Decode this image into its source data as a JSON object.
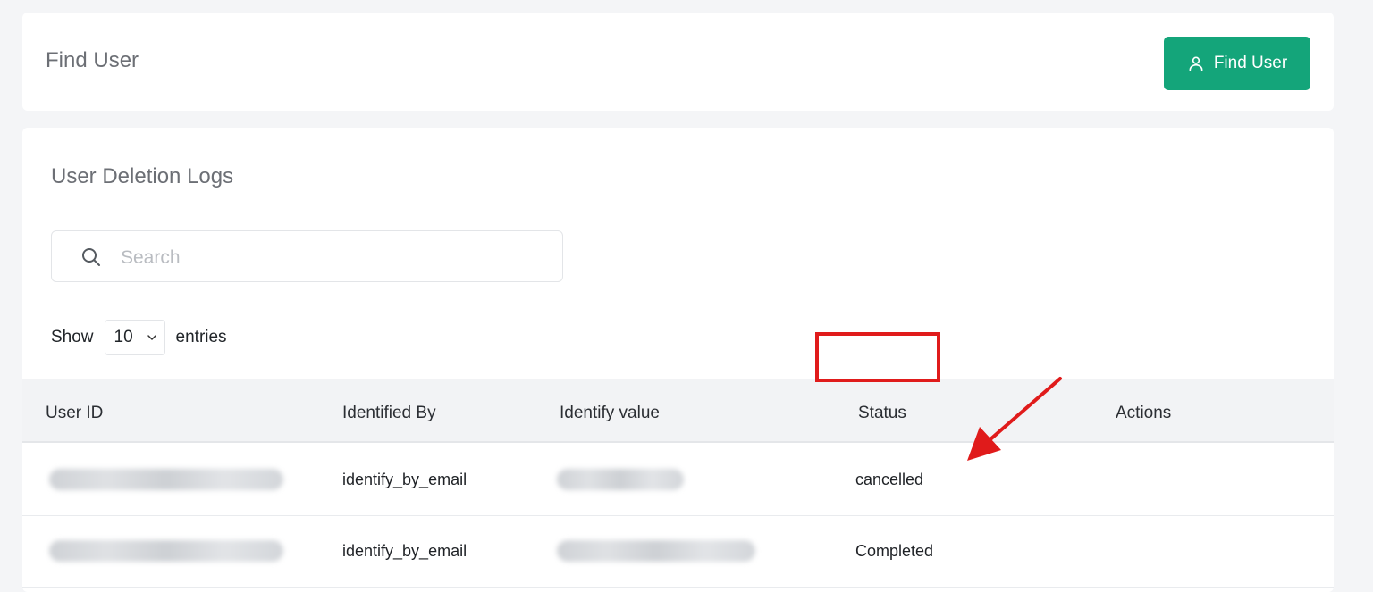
{
  "top_card": {
    "title": "Find User",
    "button_label": "Find User",
    "button_icon": "user-icon"
  },
  "logs": {
    "title": "User Deletion Logs",
    "search": {
      "placeholder": "Search",
      "value": "",
      "icon": "search-icon"
    },
    "show_label": "Show",
    "entries_value": "10",
    "entries_label": "entries",
    "columns": [
      "User ID",
      "Identified By",
      "Identify value",
      "Status",
      "Actions"
    ],
    "rows": [
      {
        "user_id": "",
        "identified_by": "identify_by_email",
        "identify_value": "",
        "status": "cancelled",
        "actions": ""
      },
      {
        "user_id": "",
        "identified_by": "identify_by_email",
        "identify_value": "",
        "status": "Completed",
        "actions": ""
      }
    ]
  },
  "colors": {
    "accent": "#14a57a",
    "annotation": "#e01b1b",
    "page_background": "#f4f5f7"
  }
}
